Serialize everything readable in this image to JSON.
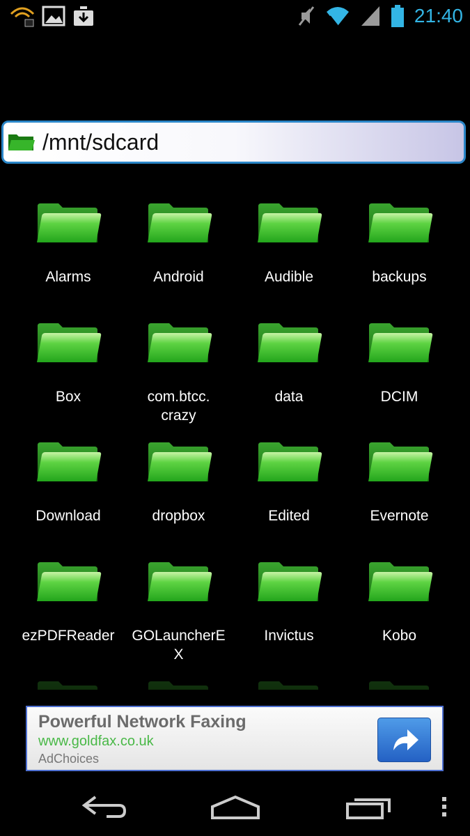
{
  "status_bar": {
    "time": "21:40",
    "left_icons": [
      "audible-icon",
      "image-icon",
      "download-icon"
    ],
    "right_icons": [
      "mute-icon",
      "wifi-icon",
      "signal-icon",
      "battery-icon"
    ]
  },
  "path_bar": {
    "path": "/mnt/sdcard",
    "icon": "folder-icon"
  },
  "folders": [
    {
      "label": "Alarms"
    },
    {
      "label": "Android"
    },
    {
      "label": "Audible"
    },
    {
      "label": "backups"
    },
    {
      "label": "Box"
    },
    {
      "label": "com.btcc.\ncrazy"
    },
    {
      "label": "data"
    },
    {
      "label": "DCIM"
    },
    {
      "label": "Download"
    },
    {
      "label": "dropbox"
    },
    {
      "label": "Edited"
    },
    {
      "label": "Evernote"
    },
    {
      "label": "ezPDFReader"
    },
    {
      "label": "GOLauncherE\nX"
    },
    {
      "label": "Invictus"
    },
    {
      "label": "Kobo"
    }
  ],
  "ad": {
    "title": "Powerful Network Faxing",
    "url": "www.goldfax.co.uk",
    "choices": "AdChoices",
    "button_icon": "share-arrow-icon"
  },
  "nav_bar": {
    "icons": [
      "back-icon",
      "home-icon",
      "recent-apps-icon",
      "overflow-menu-icon"
    ]
  },
  "colors": {
    "accent": "#33b5e5",
    "folder_green": "#33b528",
    "path_border": "#2a86c8",
    "ad_url": "#49b847"
  }
}
